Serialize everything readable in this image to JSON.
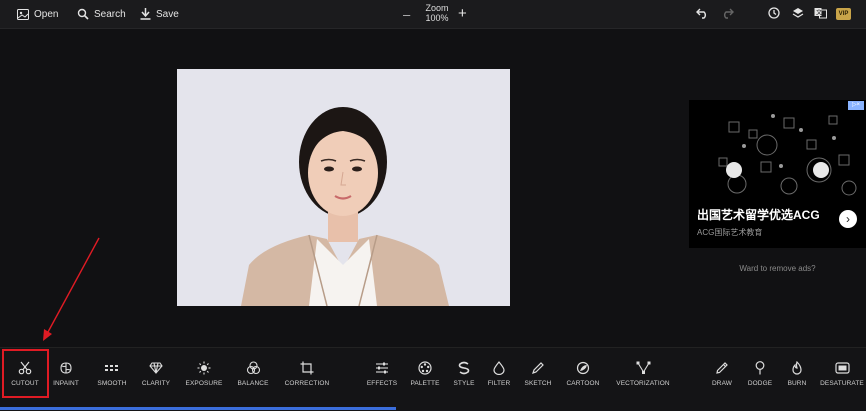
{
  "topbar": {
    "open_label": "Open",
    "search_label": "Search",
    "save_label": "Save",
    "zoom_title": "Zoom",
    "zoom_value": "100%",
    "vip_label": "VIP"
  },
  "ad": {
    "title": "出国艺术留学优选ACG",
    "subtitle": "ACG国际艺术教育",
    "remove_ads": "Ward to remove ads?"
  },
  "tools": [
    {
      "label": "CUTOUT"
    },
    {
      "label": "INPAINT"
    },
    {
      "label": "SMOOTH"
    },
    {
      "label": "CLARITY"
    },
    {
      "label": "EXPOSURE"
    },
    {
      "label": "BALANCE"
    },
    {
      "label": "CORRECTION"
    },
    {
      "label": "EFFECTS"
    },
    {
      "label": "PALETTE"
    },
    {
      "label": "STYLE"
    },
    {
      "label": "FILTER"
    },
    {
      "label": "SKETCH"
    },
    {
      "label": "CARTOON"
    },
    {
      "label": "VECTORIZATION"
    },
    {
      "label": "DRAW"
    },
    {
      "label": "DODGE"
    },
    {
      "label": "BURN"
    },
    {
      "label": "DESATURATE"
    }
  ],
  "colors": {
    "accent": "#3b6edc",
    "highlight": "#e01b24",
    "vip": "#c9a449"
  }
}
